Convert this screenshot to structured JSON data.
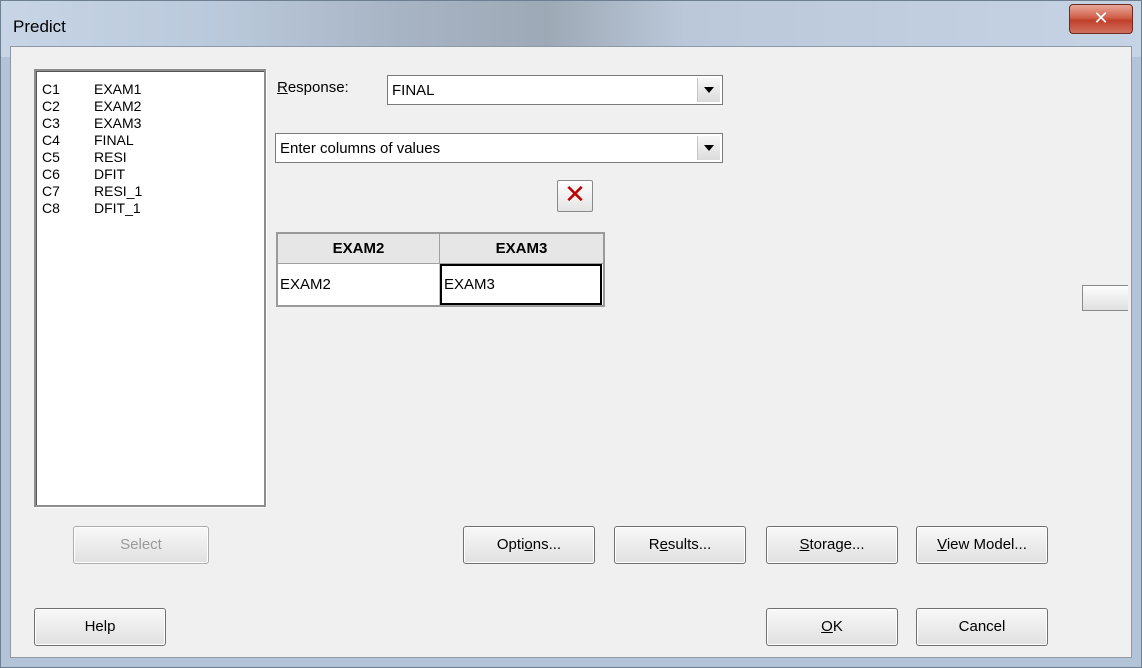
{
  "window": {
    "title": "Predict",
    "close_glyph": "✕"
  },
  "columns": [
    {
      "id": "C1",
      "name": "EXAM1"
    },
    {
      "id": "C2",
      "name": "EXAM2"
    },
    {
      "id": "C3",
      "name": "EXAM3"
    },
    {
      "id": "C4",
      "name": "FINAL"
    },
    {
      "id": "C5",
      "name": "RESI"
    },
    {
      "id": "C6",
      "name": "DFIT"
    },
    {
      "id": "C7",
      "name": "RESI_1"
    },
    {
      "id": "C8",
      "name": "DFIT_1"
    }
  ],
  "response": {
    "label_mnemonic": "R",
    "label_rest": "esponse:",
    "value": "FINAL"
  },
  "method_select": {
    "value": "Enter columns of values"
  },
  "delete_glyph": "✕",
  "predictor_table": {
    "headers": [
      "EXAM2",
      "EXAM3"
    ],
    "values": [
      "EXAM2",
      "EXAM3"
    ]
  },
  "buttons": {
    "select": "Select",
    "options_pre": "Opti",
    "options_key": "o",
    "options_post": "ns...",
    "results_pre": "R",
    "results_key": "e",
    "results_post": "sults...",
    "storage_pre": "",
    "storage_key": "S",
    "storage_post": "torage...",
    "viewmodel_pre": "",
    "viewmodel_key": "V",
    "viewmodel_post": "iew Model...",
    "help": "Help",
    "ok_key": "O",
    "ok_post": "K",
    "cancel": "Cancel"
  }
}
